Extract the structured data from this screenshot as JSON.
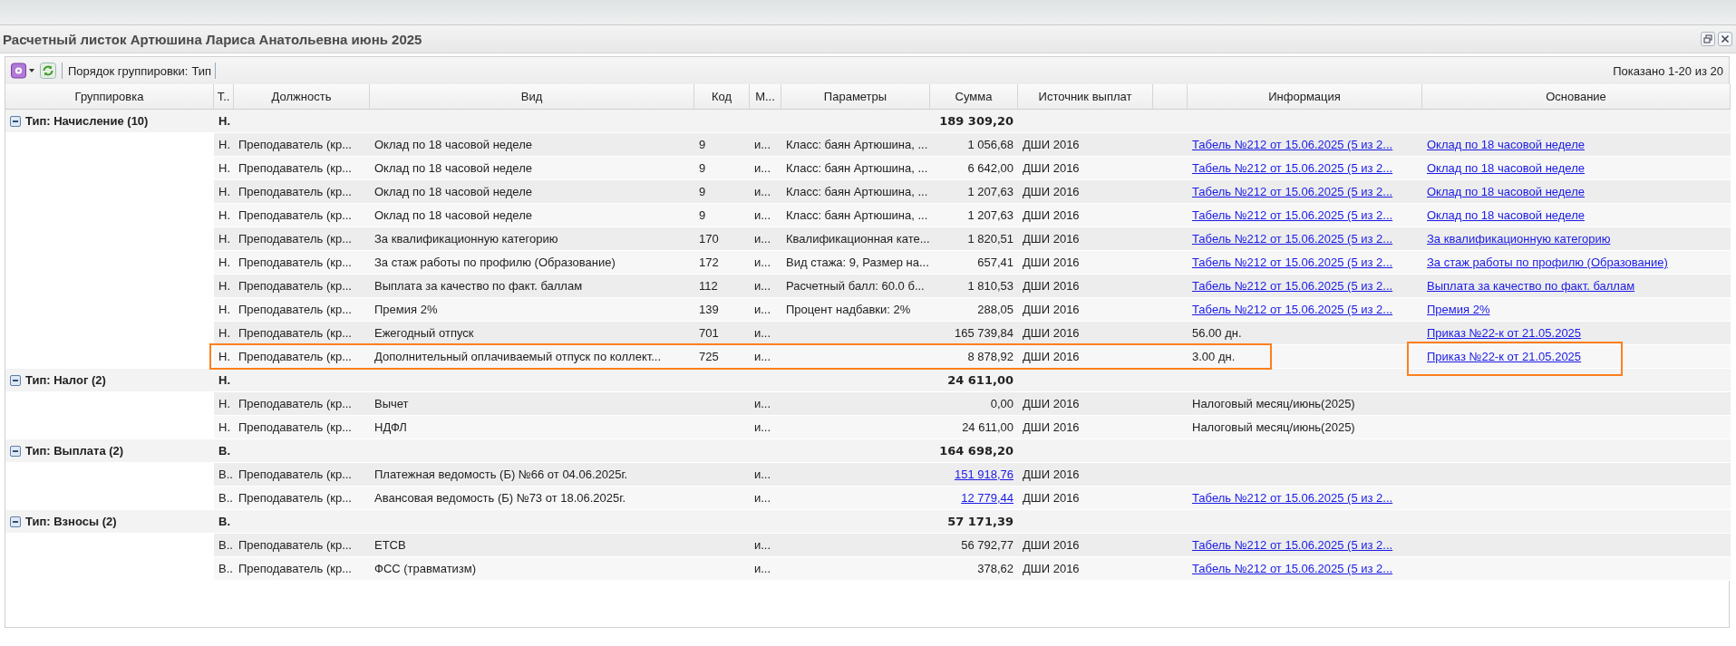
{
  "window": {
    "title": "Расчетный листок Артюшина Лариса Анатольевна июнь 2025"
  },
  "toolbar": {
    "grouping_label": "Порядок группировки:",
    "grouping_value": "Тип",
    "paging": "Показано 1-20 из 20"
  },
  "columns": [
    {
      "kind": "text",
      "label": "Группировка"
    },
    {
      "kind": "text",
      "label": "Т.."
    },
    {
      "kind": "text",
      "label": "Должность"
    },
    {
      "kind": "text",
      "label": "Вид"
    },
    {
      "kind": "text",
      "label": "Код"
    },
    {
      "kind": "text",
      "label": "М..."
    },
    {
      "kind": "text",
      "label": "Параметры"
    },
    {
      "kind": "text",
      "label": "Сумма"
    },
    {
      "kind": "text",
      "label": "Источник выплат"
    },
    {
      "kind": "blank"
    },
    {
      "kind": "text",
      "label": "Информация"
    },
    {
      "kind": "text",
      "label": "Основание"
    }
  ],
  "groups": [
    {
      "label": "Тип: Начисление (10)",
      "type": "Н.",
      "total": "189 309,20",
      "expanded": true,
      "rows": [
        {
          "type": "Н.",
          "position": "Преподаватель (кр...",
          "name": "Оклад по 18 часовой неделе",
          "code": "9",
          "m": "и...",
          "params": "Класс: баян Артюшина, ...",
          "sum": "1 056,68",
          "sum_link": false,
          "source": "ДШИ 2016",
          "info": "Табель №212 от 15.06.2025 (5 из 2...",
          "info_link": true,
          "basis": "Оклад по 18 часовой неделе",
          "basis_link": true,
          "highlighted": false,
          "basis_highlighted": false
        },
        {
          "type": "Н.",
          "position": "Преподаватель (кр...",
          "name": "Оклад по 18 часовой неделе",
          "code": "9",
          "m": "и...",
          "params": "Класс: баян Артюшина, ...",
          "sum": "6 642,00",
          "sum_link": false,
          "source": "ДШИ 2016",
          "info": "Табель №212 от 15.06.2025 (5 из 2...",
          "info_link": true,
          "basis": "Оклад по 18 часовой неделе",
          "basis_link": true,
          "highlighted": false,
          "basis_highlighted": false
        },
        {
          "type": "Н.",
          "position": "Преподаватель (кр...",
          "name": "Оклад по 18 часовой неделе",
          "code": "9",
          "m": "и...",
          "params": "Класс: баян Артюшина, ...",
          "sum": "1 207,63",
          "sum_link": false,
          "source": "ДШИ 2016",
          "info": "Табель №212 от 15.06.2025 (5 из 2...",
          "info_link": true,
          "basis": "Оклад по 18 часовой неделе",
          "basis_link": true,
          "highlighted": false,
          "basis_highlighted": false
        },
        {
          "type": "Н.",
          "position": "Преподаватель (кр...",
          "name": "Оклад по 18 часовой неделе",
          "code": "9",
          "m": "и...",
          "params": "Класс: баян Артюшина, ...",
          "sum": "1 207,63",
          "sum_link": false,
          "source": "ДШИ 2016",
          "info": "Табель №212 от 15.06.2025 (5 из 2...",
          "info_link": true,
          "basis": "Оклад по 18 часовой неделе",
          "basis_link": true,
          "highlighted": false,
          "basis_highlighted": false
        },
        {
          "type": "Н.",
          "position": "Преподаватель (кр...",
          "name": "За квалификационную категорию",
          "code": "170",
          "m": "и...",
          "params": "Квалификационная кате...",
          "sum": "1 820,51",
          "sum_link": false,
          "source": "ДШИ 2016",
          "info": "Табель №212 от 15.06.2025 (5 из 2...",
          "info_link": true,
          "basis": "За квалификационную категорию",
          "basis_link": true,
          "highlighted": false,
          "basis_highlighted": false
        },
        {
          "type": "Н.",
          "position": "Преподаватель (кр...",
          "name": "За стаж работы по профилю (Образование)",
          "code": "172",
          "m": "и...",
          "params": "Вид стажа: 9, Размер на...",
          "sum": "657,41",
          "sum_link": false,
          "source": "ДШИ 2016",
          "info": "Табель №212 от 15.06.2025 (5 из 2...",
          "info_link": true,
          "basis": "За стаж работы по профилю (Образование)",
          "basis_link": true,
          "highlighted": false,
          "basis_highlighted": false
        },
        {
          "type": "Н.",
          "position": "Преподаватель (кр...",
          "name": "Выплата за качество по факт. баллам",
          "code": "112",
          "m": "и...",
          "params": "Расчетный балл: 60.0 б...",
          "sum": "1 810,53",
          "sum_link": false,
          "source": "ДШИ 2016",
          "info": "Табель №212 от 15.06.2025 (5 из 2...",
          "info_link": true,
          "basis": "Выплата за качество по факт. баллам",
          "basis_link": true,
          "highlighted": false,
          "basis_highlighted": false
        },
        {
          "type": "Н.",
          "position": "Преподаватель (кр...",
          "name": "Премия 2%",
          "code": "139",
          "m": "и...",
          "params": "Процент надбавки: 2%",
          "sum": "288,05",
          "sum_link": false,
          "source": "ДШИ 2016",
          "info": "Табель №212 от 15.06.2025 (5 из 2...",
          "info_link": true,
          "basis": "Премия 2%",
          "basis_link": true,
          "highlighted": false,
          "basis_highlighted": false
        },
        {
          "type": "Н.",
          "position": "Преподаватель (кр...",
          "name": "Ежегодный отпуск",
          "code": "701",
          "m": "и...",
          "sum": "165 739,84",
          "sum_link": false,
          "source": "ДШИ 2016",
          "info": "56.00 дн.",
          "info_link": false,
          "basis": "Приказ №22-к от 21.05.2025",
          "basis_link": true,
          "highlighted": false,
          "basis_highlighted": false
        },
        {
          "type": "Н.",
          "position": "Преподаватель (кр...",
          "name": "Дополнительный оплачиваемый отпуск по коллект...",
          "code": "725",
          "m": "и...",
          "sum": "8 878,92",
          "sum_link": false,
          "source": "ДШИ 2016",
          "info": "3.00 дн.",
          "info_link": false,
          "basis": "Приказ №22-к от 21.05.2025",
          "basis_link": true,
          "highlighted": true,
          "basis_highlighted": true
        }
      ]
    },
    {
      "label": "Тип: Налог (2)",
      "type": "Н.",
      "total": "24 611,00",
      "expanded": true,
      "rows": [
        {
          "type": "Н.",
          "position": "Преподаватель (кр...",
          "name": "Вычет",
          "m": "и...",
          "sum": "0,00",
          "sum_link": false,
          "source": "ДШИ 2016",
          "info": "Налоговый месяц/июнь(2025)",
          "info_link": false,
          "highlighted": false,
          "basis_highlighted": false
        },
        {
          "type": "Н.",
          "position": "Преподаватель (кр...",
          "name": "НДФЛ",
          "m": "и...",
          "sum": "24 611,00",
          "sum_link": false,
          "source": "ДШИ 2016",
          "info": "Налоговый месяц/июнь(2025)",
          "info_link": false,
          "highlighted": false,
          "basis_highlighted": false
        }
      ]
    },
    {
      "label": "Тип: Выплата (2)",
      "type": "В.",
      "total": "164 698,20",
      "expanded": true,
      "rows": [
        {
          "type": "В..",
          "position": "Преподаватель (кр...",
          "name": "Платежная ведомость (Б) №66 от 04.06.2025г.",
          "m": "и...",
          "sum": "151 918,76",
          "sum_link": true,
          "source": "ДШИ 2016",
          "highlighted": false,
          "basis_highlighted": false
        },
        {
          "type": "В..",
          "position": "Преподаватель (кр...",
          "name": "Авансовая ведомость (Б) №73 от 18.06.2025г.",
          "m": "и...",
          "sum": "12 779,44",
          "sum_link": true,
          "source": "ДШИ 2016",
          "info": "Табель №212 от 15.06.2025 (5 из 2...",
          "info_link": true,
          "highlighted": false,
          "basis_highlighted": false
        }
      ]
    },
    {
      "label": "Тип: Взносы (2)",
      "type": "В.",
      "total": "57 171,39",
      "expanded": true,
      "rows": [
        {
          "type": "В..",
          "position": "Преподаватель (кр...",
          "name": "ЕТСВ",
          "m": "и...",
          "sum": "56 792,77",
          "sum_link": false,
          "source": "ДШИ 2016",
          "info": "Табель №212 от 15.06.2025 (5 из 2...",
          "info_link": true,
          "highlighted": false,
          "basis_highlighted": false
        },
        {
          "type": "В..",
          "position": "Преподаватель (кр...",
          "name": "ФСС (травматизм)",
          "m": "и...",
          "sum": "378,62",
          "sum_link": false,
          "source": "ДШИ 2016",
          "info": "Табель №212 от 15.06.2025 (5 из 2...",
          "info_link": true,
          "highlighted": false,
          "basis_highlighted": false
        }
      ]
    }
  ]
}
